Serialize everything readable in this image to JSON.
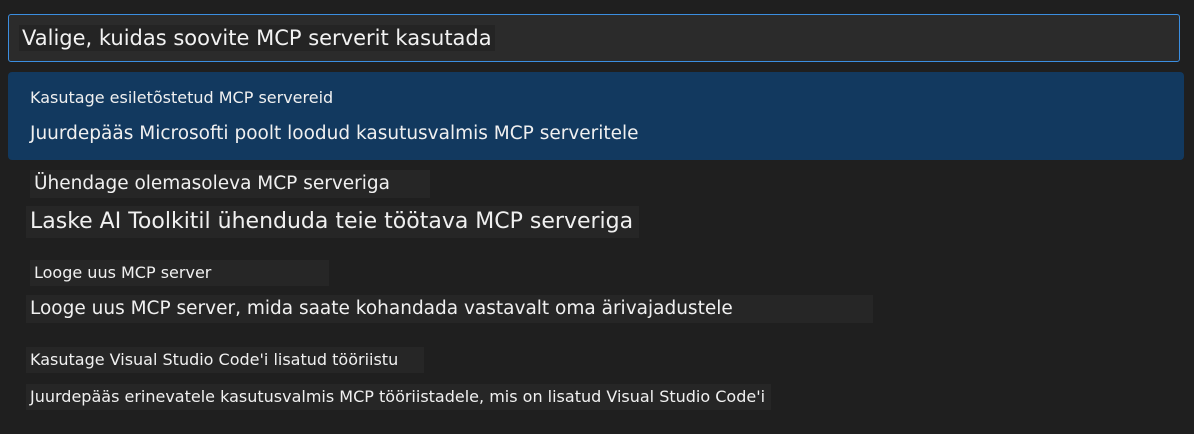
{
  "quick_pick": {
    "query": "Valige, kuidas soovite MCP serverit kasutada",
    "options": [
      {
        "title": "Kasutage esiletõstetud MCP servereid",
        "description": "Juurdepääs Microsofti poolt loodud kasutusvalmis MCP serveritele"
      },
      {
        "title": "Ühendage olemasoleva MCP serveriga",
        "description": "Laske AI Toolkitil ühenduda teie töötava MCP serveriga"
      },
      {
        "title": "Looge uus MCP server",
        "description": "Looge uus MCP server, mida saate kohandada vastavalt oma ärivajadustele"
      },
      {
        "title": "Kasutage Visual Studio Code'i lisatud tööriistu",
        "description": "Juurdepääs erinevatele kasutusvalmis MCP tööriistadele, mis on lisatud Visual Studio Code'i"
      }
    ]
  }
}
